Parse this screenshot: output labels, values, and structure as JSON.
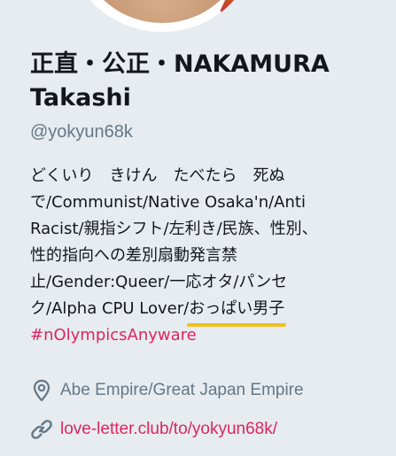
{
  "profile": {
    "display_name_line1": "正直・公正・NAKAMURA",
    "display_name_line2": "Takashi",
    "handle": "@yokyun68k",
    "bio": {
      "line1": "どくいり　きけん　たべたら　死ぬ",
      "line2": "で/Communist/Native Osaka'n/Anti",
      "line3": "Racist/親指シフト/左利き/民族、性別、",
      "line4": "性的指向への差別扇動発言禁",
      "line5": "止/Gender:Queer/一応オタ/パンセ",
      "line6_prefix": "ク/Alpha CPU Lover/",
      "line6_highlight": "おっぱい男子",
      "hashtag": "#nOlympicsAnyware"
    },
    "location": "Abe Empire/Great Japan Empire",
    "website": "love-letter.club/to/yokyun68k/"
  },
  "colors": {
    "background": "#e6ecf0",
    "hashtag": "#e0245e",
    "secondary_text": "#657786",
    "highlight_underline": "#f2c21b"
  },
  "icons": {
    "location": "location-pin-icon",
    "website": "link-icon"
  }
}
